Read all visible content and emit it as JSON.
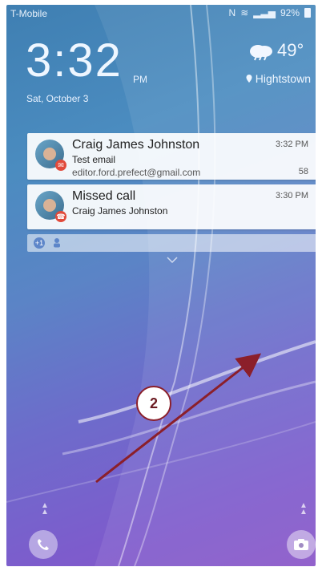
{
  "status_bar": {
    "carrier": "T-Mobile",
    "battery": "92%",
    "icons": [
      "nfc-icon",
      "wifi-icon",
      "signal-icon",
      "battery-icon"
    ]
  },
  "lock": {
    "time": "3:32",
    "ampm": "PM",
    "date": "Sat, October 3"
  },
  "weather": {
    "icon": "cloud-rain-icon",
    "temp": "49°",
    "location": "Hightstown"
  },
  "notifications": [
    {
      "title": "Craig James Johnston",
      "subtitle": "Test email",
      "detail": "editor.ford.prefect@gmail.com",
      "time": "3:32 PM",
      "count": "58",
      "badge": "mail-icon"
    },
    {
      "title": "Missed call",
      "subtitle": "Craig James Johnston",
      "time": "3:30 PM",
      "badge": "missed-call-icon"
    }
  ],
  "quickbar": {
    "plus_count": "+1"
  },
  "annotation": {
    "step": "2"
  },
  "colors": {
    "accent_red": "#8b1f2a",
    "badge_red": "#e14a3b"
  }
}
